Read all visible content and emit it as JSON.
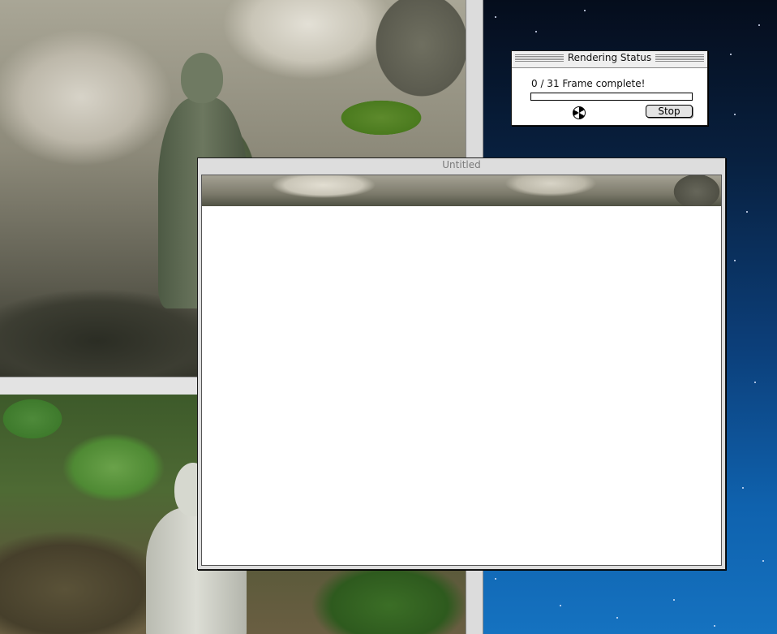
{
  "windows": {
    "untitled": {
      "title": "Untitled"
    },
    "rendering_status": {
      "title": "Rendering Status",
      "status_text": "0 / 31 Frame complete!",
      "progress": 0,
      "stop_label": "Stop"
    }
  }
}
